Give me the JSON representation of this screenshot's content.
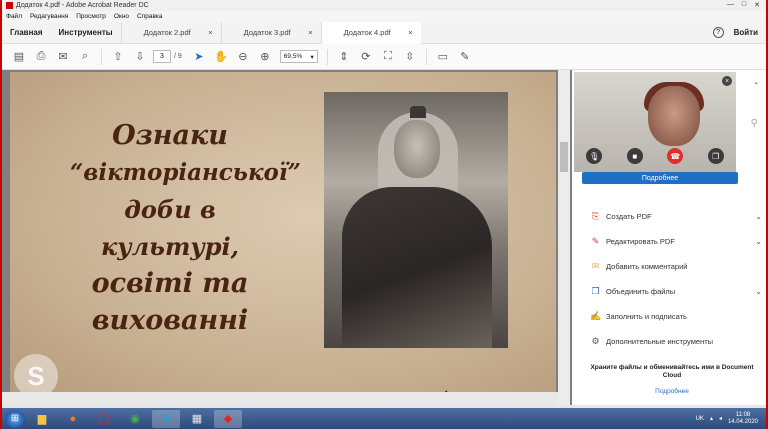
{
  "window": {
    "title": "Додаток 4.pdf - Adobe Acrobat Reader DC",
    "controls": [
      "—",
      "□",
      "✕"
    ]
  },
  "menu": [
    "Файл",
    "Редагування",
    "Просмотр",
    "Окно",
    "Справка"
  ],
  "tabs": {
    "home": "Главная",
    "tools": "Инструменты",
    "documents": [
      {
        "label": "Додаток 2.pdf",
        "active": false
      },
      {
        "label": "Додаток 3.pdf",
        "active": false
      },
      {
        "label": "Додаток 4.pdf",
        "active": true
      }
    ],
    "close_glyph": "×",
    "sign_in": "Войти",
    "help": "?"
  },
  "toolbar": {
    "current_page": "3",
    "total_pages": "/ 9",
    "zoom": "69,5%",
    "icons": [
      "save-icon",
      "print-icon",
      "mail-icon",
      "search-icon",
      "page-up-icon",
      "page-down-icon",
      "select-icon",
      "hand-icon",
      "zoom-out-icon",
      "zoom-in-icon",
      "fit-icon",
      "rotate-icon",
      "fullscreen-icon",
      "scroll-icon",
      "comment-icon",
      "pen-icon"
    ]
  },
  "slide": {
    "title_lines": [
      "Ознаки",
      "“вікторіанської”",
      "доби в культурі,",
      "освіті та",
      "вихованні"
    ],
    "title_color": "#4a2412"
  },
  "call": {
    "close": "×",
    "more_button": "Подробнее"
  },
  "tools_panel": [
    {
      "label": "Создать PDF",
      "icon": "create-pdf-icon",
      "glyph": "⎘",
      "color": "#d9443a",
      "chevron": true
    },
    {
      "label": "Редактировать PDF",
      "icon": "edit-pdf-icon",
      "glyph": "✎",
      "color": "#d9443a",
      "chevron": true
    },
    {
      "label": "Добавить комментарий",
      "icon": "comment-icon",
      "glyph": "✉",
      "color": "#e6b32a",
      "chevron": false
    },
    {
      "label": "Объединить файлы",
      "icon": "combine-icon",
      "glyph": "❐",
      "color": "#2a64c4",
      "chevron": true
    },
    {
      "label": "Заполнить и подписать",
      "icon": "sign-icon",
      "glyph": "✍",
      "color": "#7b46b8",
      "chevron": false
    },
    {
      "label": "Дополнительные инструменты",
      "icon": "more-tools-icon",
      "glyph": "⚙",
      "color": "#555555",
      "chevron": false
    }
  ],
  "cloud": {
    "text": "Храните файлы и обменивайтесь ими в Document Cloud",
    "link": "Подробнее"
  },
  "taskbar": {
    "lang": "UK",
    "time": "11:08",
    "date": "14.04.2020"
  },
  "colors": {
    "accent": "#1f6fc5",
    "hangup": "#e0302a"
  }
}
